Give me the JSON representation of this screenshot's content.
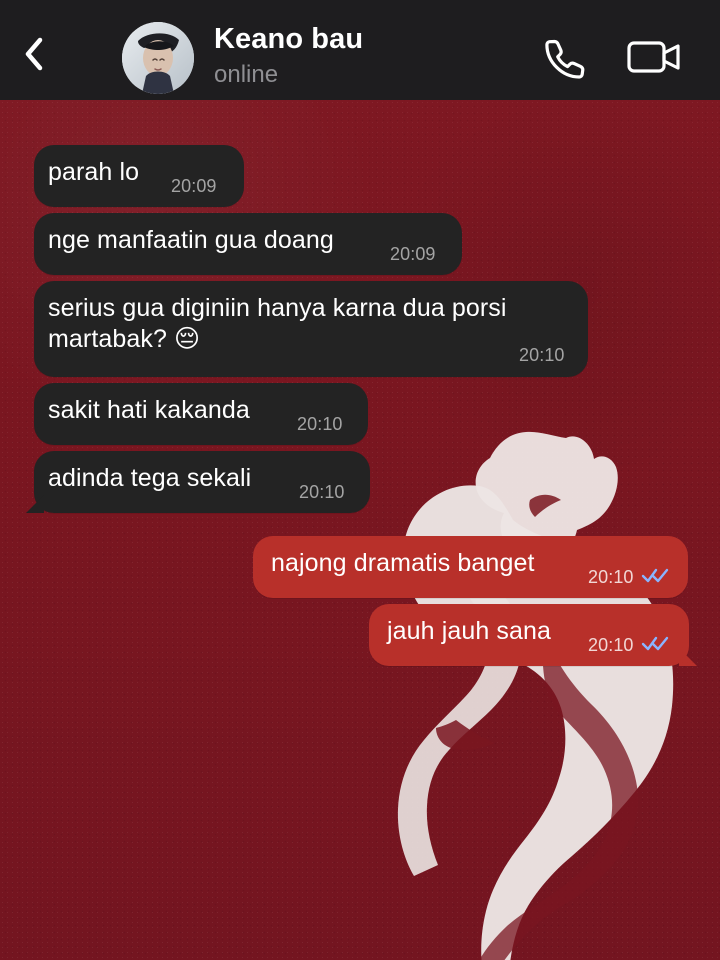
{
  "header": {
    "contact_name": "Keano bau",
    "status": "online"
  },
  "messages": [
    {
      "text": "parah lo",
      "time": "20:09"
    },
    {
      "text": "nge manfaatin gua doang",
      "time": "20:09"
    },
    {
      "text": "serius gua diginiin hanya karna dua porsi martabak? 😔",
      "time": "20:10"
    },
    {
      "text": "sakit hati kakanda",
      "time": "20:10"
    },
    {
      "text": "adinda tega sekali",
      "time": "20:10"
    },
    {
      "text": "najong dramatis banget",
      "time": "20:10"
    },
    {
      "text": "jauh jauh sana",
      "time": "20:10"
    }
  ],
  "icons": {
    "back": "chevron-left-icon",
    "call": "phone-icon",
    "video": "video-camera-icon",
    "ticks": "double-check-icon"
  },
  "colors": {
    "header_bg": "#1e1d1f",
    "incoming_bubble": "#232323",
    "outgoing_bubble": "#b8302a",
    "tick_color": "#8ab4ff"
  }
}
